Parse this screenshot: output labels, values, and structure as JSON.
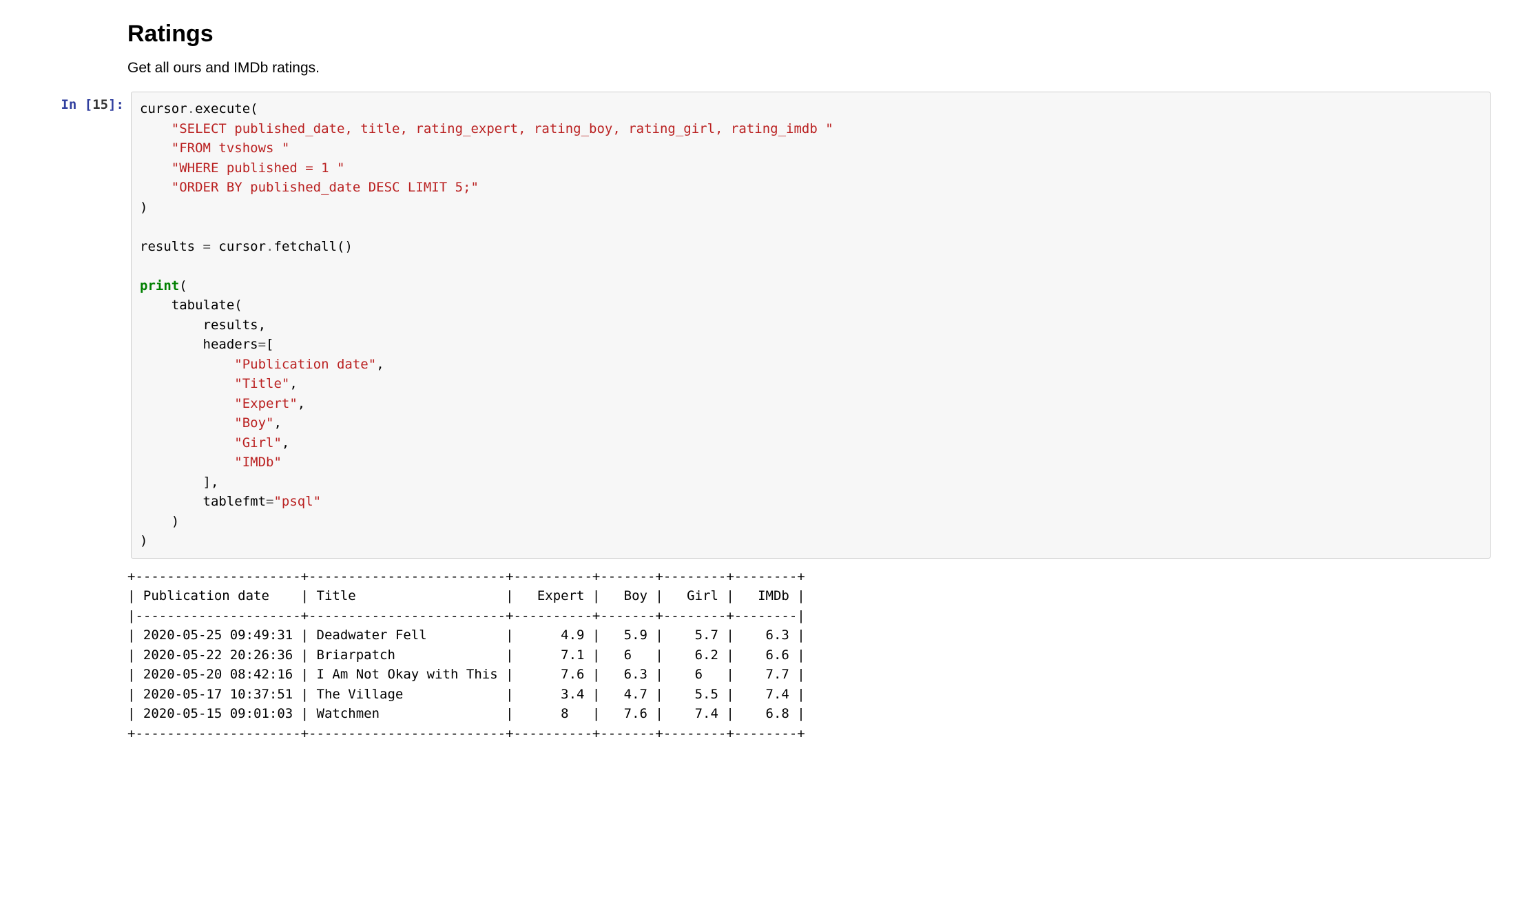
{
  "heading": "Ratings",
  "subtext": "Get all ours and IMDb ratings.",
  "prompt": {
    "kw": "In ",
    "open": "[",
    "num": "15",
    "close": "]:"
  },
  "code": {
    "l1": "cursor",
    "l1b": ".",
    "l1c": "execute",
    "l1d": "(",
    "l2": "    ",
    "l2s": "\"SELECT published_date, title, rating_expert, rating_boy, rating_girl, rating_imdb \"",
    "l3": "    ",
    "l3s": "\"FROM tvshows \"",
    "l4": "    ",
    "l4s": "\"WHERE published = 1 \"",
    "l5": "    ",
    "l5s": "\"ORDER BY published_date DESC LIMIT 5;\"",
    "l6": ")",
    "blank1": "",
    "l7a": "results ",
    "l7b": "=",
    "l7c": " cursor",
    "l7d": ".",
    "l7e": "fetchall",
    "l7f": "()",
    "blank2": "",
    "l8a": "print",
    "l8b": "(",
    "l9": "    tabulate(",
    "l10": "        results,",
    "l11": "        headers",
    "l11b": "=",
    "l11c": "[",
    "l12": "            ",
    "l12s": "\"Publication date\"",
    "l12c": ",",
    "l13": "            ",
    "l13s": "\"Title\"",
    "l13c": ",",
    "l14": "            ",
    "l14s": "\"Expert\"",
    "l14c": ",",
    "l15": "            ",
    "l15s": "\"Boy\"",
    "l15c": ",",
    "l16": "            ",
    "l16s": "\"Girl\"",
    "l16c": ",",
    "l17": "            ",
    "l17s": "\"IMDb\"",
    "l18": "        ],",
    "l19": "        tablefmt",
    "l19b": "=",
    "l19s": "\"psql\"",
    "l20": "    )",
    "l21": ")"
  },
  "output_lines": [
    "+---------------------+-------------------------+----------+-------+--------+--------+",
    "| Publication date    | Title                   |   Expert |   Boy |   Girl |   IMDb |",
    "|---------------------+-------------------------+----------+-------+--------+--------|",
    "| 2020-05-25 09:49:31 | Deadwater Fell          |      4.9 |   5.9 |    5.7 |    6.3 |",
    "| 2020-05-22 20:26:36 | Briarpatch              |      7.1 |   6   |    6.2 |    6.6 |",
    "| 2020-05-20 08:42:16 | I Am Not Okay with This |      7.6 |   6.3 |    6   |    7.7 |",
    "| 2020-05-17 10:37:51 | The Village             |      3.4 |   4.7 |    5.5 |    7.4 |",
    "| 2020-05-15 09:01:03 | Watchmen                |      8   |   7.6 |    7.4 |    6.8 |",
    "+---------------------+-------------------------+----------+-------+--------+--------+"
  ],
  "chart_data": {
    "type": "table",
    "columns": [
      "Publication date",
      "Title",
      "Expert",
      "Boy",
      "Girl",
      "IMDb"
    ],
    "rows": [
      [
        "2020-05-25 09:49:31",
        "Deadwater Fell",
        4.9,
        5.9,
        5.7,
        6.3
      ],
      [
        "2020-05-22 20:26:36",
        "Briarpatch",
        7.1,
        6,
        6.2,
        6.6
      ],
      [
        "2020-05-20 08:42:16",
        "I Am Not Okay with This",
        7.6,
        6.3,
        6,
        7.7
      ],
      [
        "2020-05-17 10:37:51",
        "The Village",
        3.4,
        4.7,
        5.5,
        7.4
      ],
      [
        "2020-05-15 09:01:03",
        "Watchmen",
        8,
        7.6,
        7.4,
        6.8
      ]
    ]
  }
}
